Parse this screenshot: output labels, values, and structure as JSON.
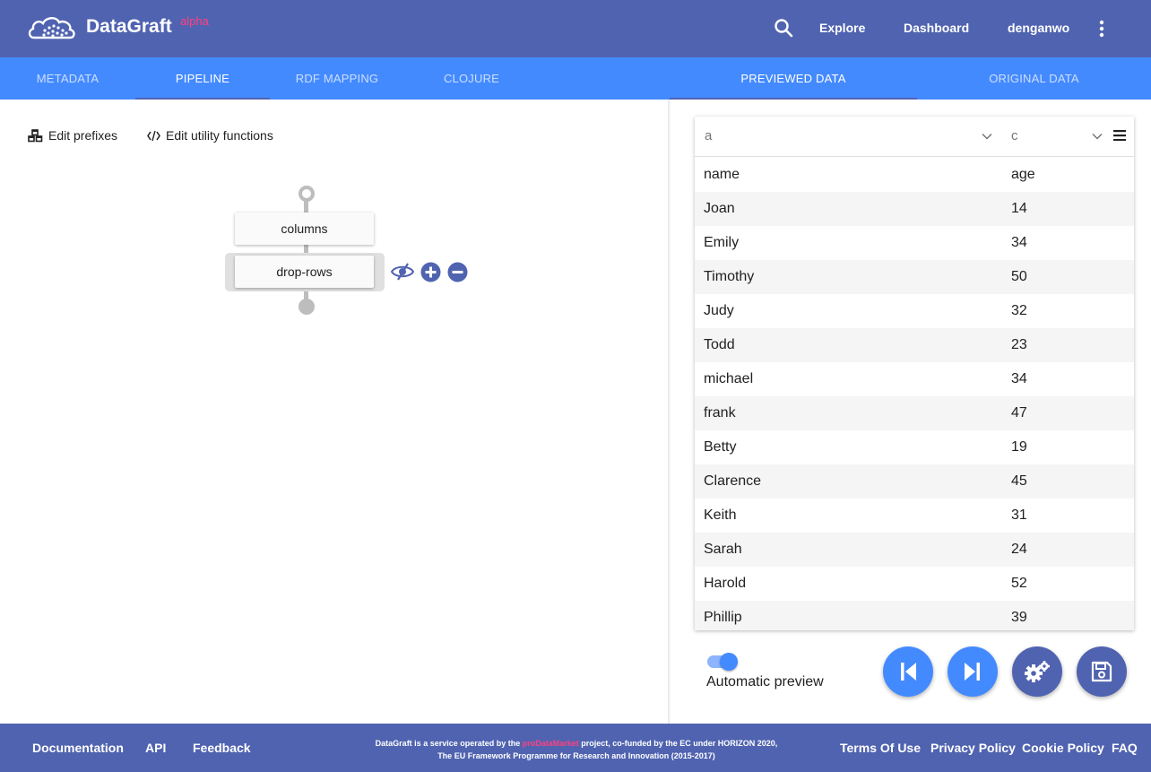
{
  "header": {
    "brand": "DataGraft",
    "brand_tag": "alpha",
    "nav": {
      "explore": "Explore",
      "dashboard": "Dashboard",
      "user": "denganwo"
    },
    "icons": {
      "logo": "cloud-logo-icon",
      "search": "search-icon",
      "more": "more-vert-icon"
    }
  },
  "left_tabs": [
    {
      "label": "METADATA",
      "active": false
    },
    {
      "label": "PIPELINE",
      "active": true
    },
    {
      "label": "RDF MAPPING",
      "active": false
    },
    {
      "label": "CLOJURE",
      "active": false
    }
  ],
  "right_tabs": [
    {
      "label": "PREVIEWED DATA",
      "active": true
    },
    {
      "label": "ORIGINAL DATA",
      "active": false
    }
  ],
  "pipeline": {
    "edit_prefixes": "Edit prefixes",
    "edit_utility_functions": "Edit utility functions",
    "steps": [
      {
        "label": "columns"
      },
      {
        "label": "drop-rows",
        "selected": true
      }
    ],
    "step_actions": [
      "visibility-off-icon",
      "add-circle-icon",
      "remove-circle-icon"
    ]
  },
  "table": {
    "column_selects": [
      "a",
      "c"
    ],
    "rows": [
      [
        "name",
        "age"
      ],
      [
        "Joan",
        "14"
      ],
      [
        "Emily",
        "34"
      ],
      [
        "Timothy",
        "50"
      ],
      [
        "Judy",
        "32"
      ],
      [
        "Todd",
        "23"
      ],
      [
        "michael",
        "34"
      ],
      [
        "frank",
        "47"
      ],
      [
        "Betty",
        "19"
      ],
      [
        "Clarence",
        "45"
      ],
      [
        "Keith",
        "31"
      ],
      [
        "Sarah",
        "24"
      ],
      [
        "Harold",
        "52"
      ],
      [
        "Phillip",
        "39"
      ]
    ]
  },
  "preview": {
    "automatic_preview_label": "Automatic preview",
    "automatic_preview_on": true,
    "actions": [
      "skip-previous-icon",
      "skip-next-icon",
      "settings-icon",
      "save-icon"
    ]
  },
  "footer": {
    "links_left": [
      "Documentation",
      "API",
      "Feedback"
    ],
    "text_before": "DataGraft is a service operated by the ",
    "text_brand": "proDataMarket",
    "text_after": " project, co-funded by the EC under HORIZON 2020, The EU Framework Programme for Research and Innovation (2015-2017)",
    "links_right": [
      "Terms Of Use",
      "Privacy Policy",
      "Cookie Policy",
      "FAQ"
    ]
  },
  "colors": {
    "header": "#5063b0",
    "tab_bar": "#448aff",
    "accent_pink": "#ff4081"
  }
}
